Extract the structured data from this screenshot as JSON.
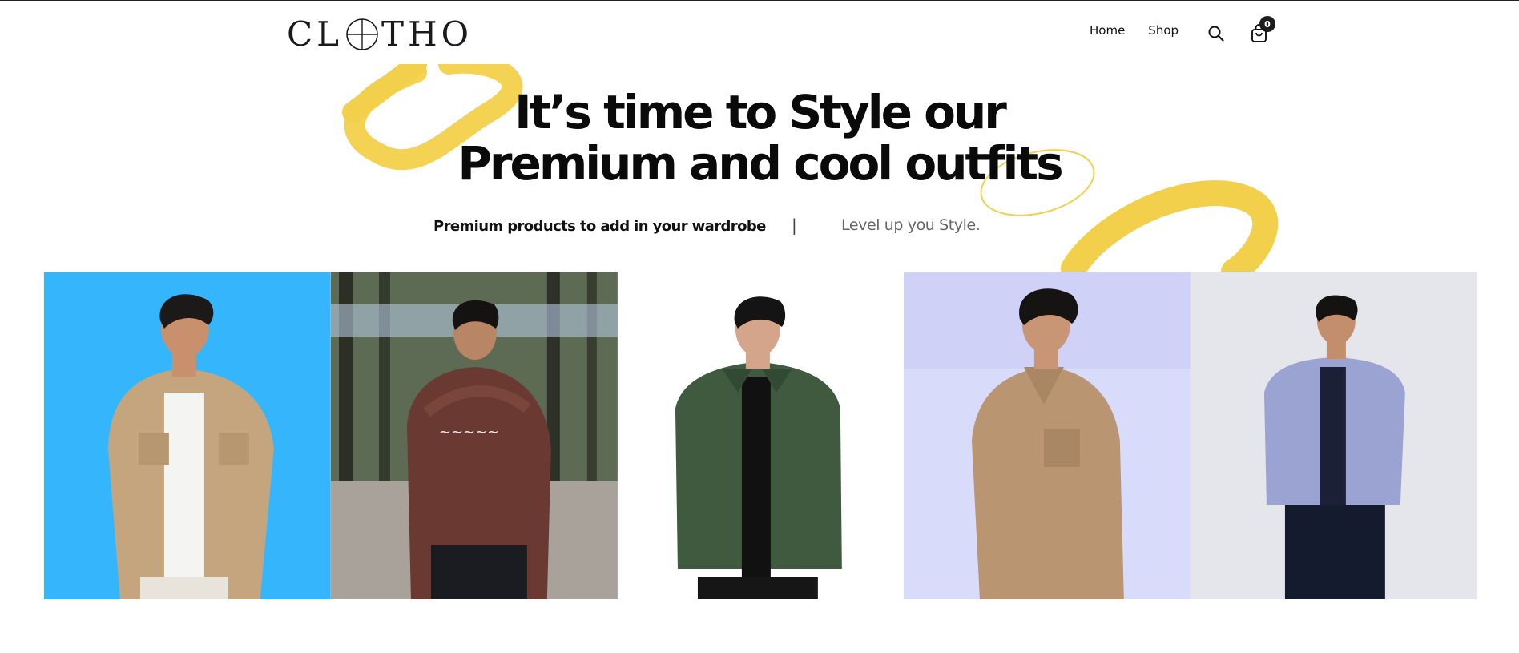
{
  "brand": {
    "logo_text_left": "CL",
    "logo_text_right": "THO",
    "logo_alt": "CLOTHO"
  },
  "nav": {
    "items": [
      "Home",
      "Shop"
    ],
    "search_icon": "search-icon",
    "cart_icon": "shopping-bag-icon",
    "cart_count": "0"
  },
  "hero": {
    "headline_line1": "It’s time to Style our",
    "headline_line2": "Premium and cool outfits",
    "tagline_left": "Premium products to add in your wardrobe",
    "separator": "|",
    "tagline_right": "Level up you Style.",
    "accent_color": "#f2d04b"
  },
  "gallery": {
    "photos": [
      {
        "name": "model-tan-shirt-jacket",
        "background": "#35b5fb",
        "garment": "#c4a57e"
      },
      {
        "name": "model-maroon-hoodie",
        "background": "#7d8e80",
        "garment": "#6a3a32"
      },
      {
        "name": "model-green-jacket",
        "background": "#ffffff",
        "garment": "#3f5a3f"
      },
      {
        "name": "model-tan-jacket-lavender",
        "background": "#d9dbfa",
        "garment": "#b99671"
      },
      {
        "name": "model-blue-jacket",
        "background": "#e4e6ec",
        "garment": "#9aa3d1"
      }
    ]
  }
}
